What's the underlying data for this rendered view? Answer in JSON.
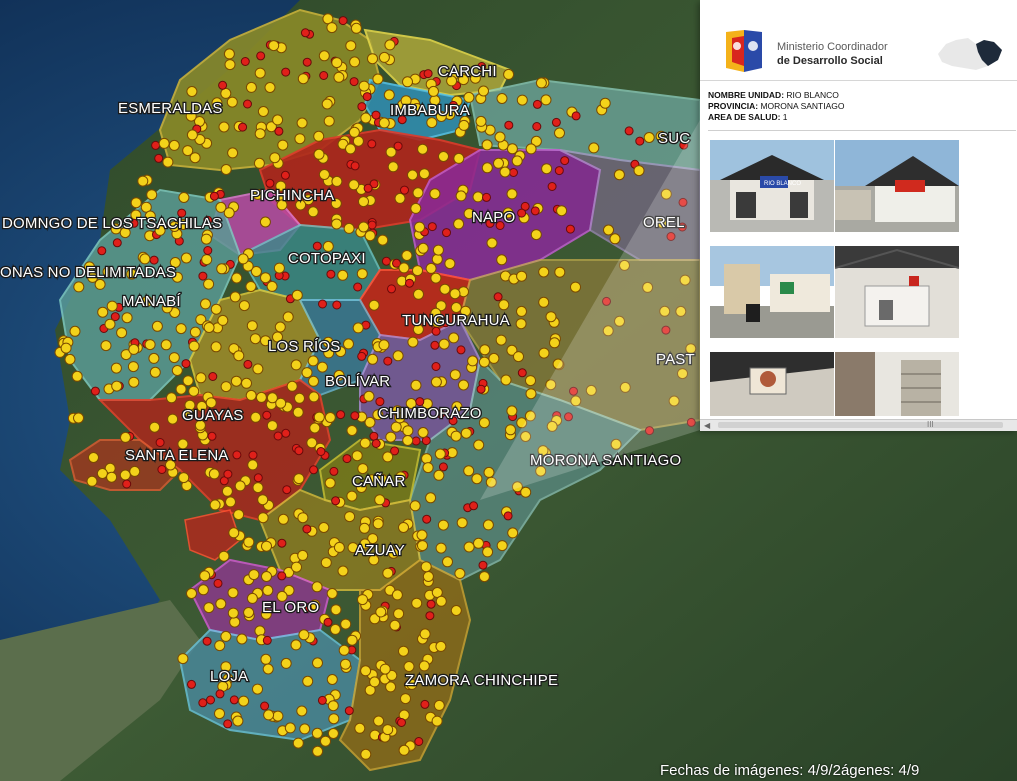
{
  "map": {
    "provinces": [
      "ESMERALDAS",
      "CARCHI",
      "IMBABURA",
      "SUCUMBÍOS",
      "PICHINCHA",
      "NAPO",
      "ORELLANA",
      "SANTO DOMINGO DE LOS TSACHILAS",
      "ZONAS NO DELIMITADAS",
      "COTOPAXI",
      "MANABÍ",
      "TUNGURAHUA",
      "PASTAZA",
      "LOS RÍOS",
      "BOLÍVAR",
      "CHIMBORAZO",
      "GUAYAS",
      "SANTA ELENA",
      "MORONA SANTIAGO",
      "CAÑAR",
      "AZUAY",
      "EL ORO",
      "LOJA",
      "ZAMORA CHINCHIPE"
    ],
    "labels": {
      "esmeraldas": "ESMERALDAS",
      "carchi": "CARCHI",
      "imbabura": "IMBABURA",
      "sucumbios": "SUC",
      "pichincha": "PICHINCHA",
      "napo": "NAPO",
      "orellana": "OREL",
      "santo_domingo": "DOMNGO DE LOS TSACHILAS",
      "zonas": "ONAS NO DELIMITADAS",
      "cotopaxi": "COTOPAXI",
      "manabi": "MANABÍ",
      "tungurahua": "TUNGURAHUA",
      "pastaza": "PAST",
      "los_rios": "LOS RÍOS",
      "bolivar": "BOLÍVAR",
      "chimborazo": "CHIMBORAZO",
      "guayas": "GUAYAS",
      "santa_elena": "SANTA ELENA",
      "morona": "MORONA SANTIAGO",
      "canar": "CAÑAR",
      "azuay": "AZUAY",
      "el_oro": "EL ORO",
      "loja": "LOJA",
      "zamora": "ZAMORA CHINCHIPE"
    },
    "imagery_date": "Fechas de imágenes: 4/9/2",
    "imagery_date2": "ágenes: 4/9",
    "marker_color": "#f3d21a",
    "alt_marker_color": "#e0201a"
  },
  "popup": {
    "org_line1": "Ministerio Coordinador",
    "org_line2": "de Desarrollo Social",
    "fields": [
      {
        "label": "NOMBRE UNIDAD:",
        "value": "RIO BLANCO"
      },
      {
        "label": "PROVINCIA:",
        "value": "MORONA SANTIAGO"
      },
      {
        "label": "AREA DE SALUD:",
        "value": "1"
      }
    ],
    "sign_text": "RIO BLANCO",
    "scroll_grip": "III"
  }
}
